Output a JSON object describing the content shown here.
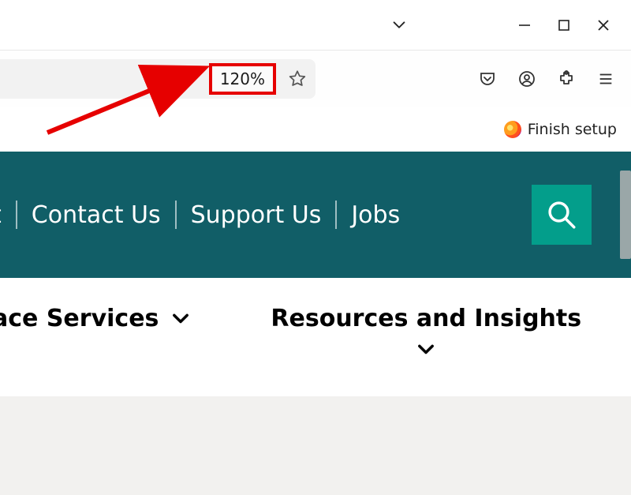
{
  "window": {
    "tab_dropdown": "⌄"
  },
  "toolbar": {
    "zoom_level": "120%",
    "finish_setup_label": "Finish setup"
  },
  "nav": {
    "links": [
      "t",
      "Contact Us",
      "Support Us",
      "Jobs"
    ]
  },
  "subnav": {
    "item1": "ace Services",
    "item2": "Resources and Insights"
  },
  "icons": {
    "star": "star-icon",
    "pocket": "pocket-icon",
    "account": "account-icon",
    "extensions": "extensions-icon",
    "menu": "menu-icon",
    "search": "search-icon",
    "chevron_down": "chevron-down-icon",
    "minimize": "minimize-icon",
    "maximize": "maximize-icon",
    "close": "close-icon"
  },
  "colors": {
    "teal": "#115e67",
    "search_btn": "#039e8b",
    "highlight_red": "#e60000"
  }
}
